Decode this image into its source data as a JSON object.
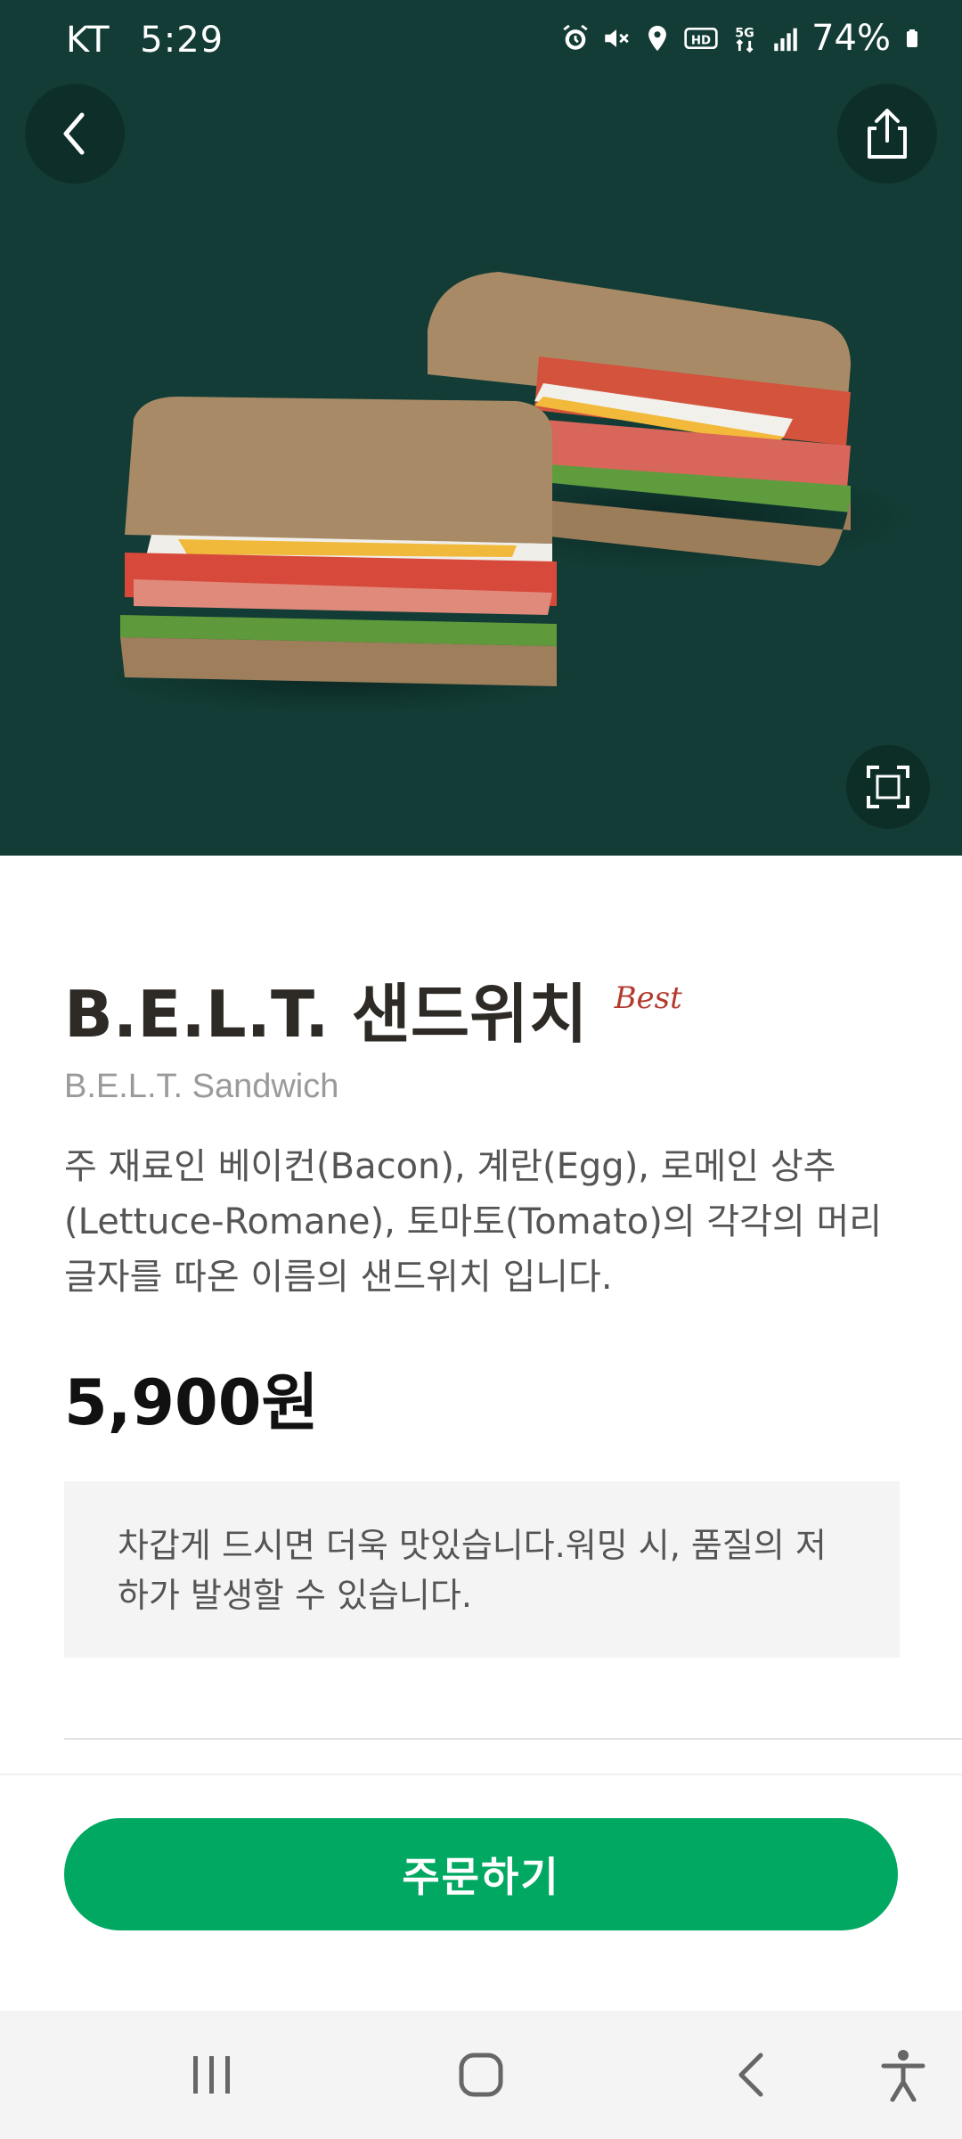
{
  "status_bar": {
    "carrier": "KT",
    "time": "5:29",
    "battery": "74%",
    "icons": [
      "alarm-icon",
      "mute-icon",
      "location-icon",
      "hd-icon",
      "5g-icon",
      "signal-icon",
      "battery-icon"
    ]
  },
  "hero": {
    "image": "sandwich-image",
    "background": "#123c35"
  },
  "product": {
    "name_ko": "B.E.L.T. 샌드위치",
    "badge": "Best",
    "name_en": "B.E.L.T. Sandwich",
    "description": "주 재료인 베이컨(Bacon), 계란(Egg), 로메인 상추(Lettuce-Romane), 토마토(Tomato)의 각각의 머리 글자를 따온 이름의 샌드위치 입니다.",
    "price": "5,900원",
    "notice": "차갑게 드시면 더욱 맛있습니다.워밍 시, 품질의 저하가 발생할 수 있습니다."
  },
  "actions": {
    "order_label": "주문하기"
  },
  "colors": {
    "accent": "#00a862",
    "badge": "#b23b2e"
  },
  "nav_bar": {
    "icons": [
      "recent-apps-icon",
      "home-icon",
      "back-icon",
      "accessibility-icon"
    ]
  }
}
